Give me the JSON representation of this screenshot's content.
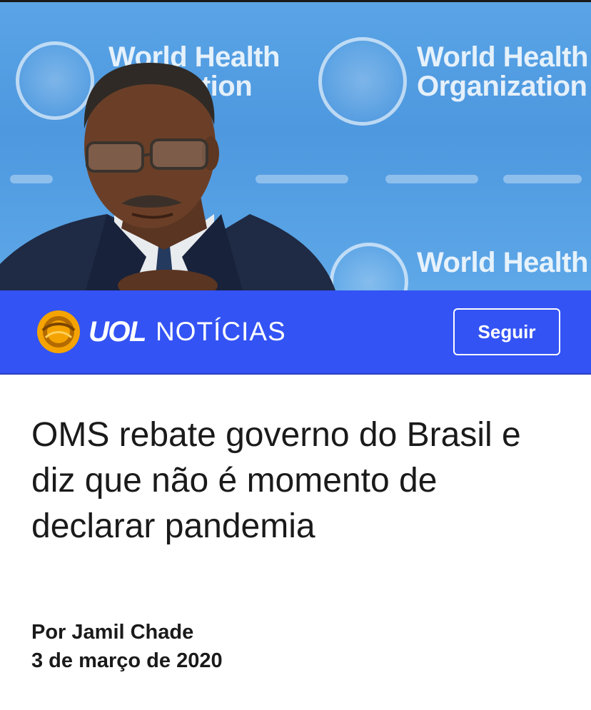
{
  "hero": {
    "background_text_1": "World Health",
    "background_text_2": "Organization",
    "background_text_partial_1": "World Health",
    "background_text_partial_2": "ization",
    "background_text_3": "World Health"
  },
  "brand": {
    "logo_text": "UOL",
    "section": "NOTÍCIAS",
    "follow_label": "Seguir",
    "colors": {
      "bar": "#3353f4",
      "logo_gold": "#f5a300"
    }
  },
  "article": {
    "headline": "OMS rebate governo do Brasil e diz que não é momento de declarar pandemia",
    "author": "Por Jamil Chade",
    "date": "3 de março de 2020"
  }
}
